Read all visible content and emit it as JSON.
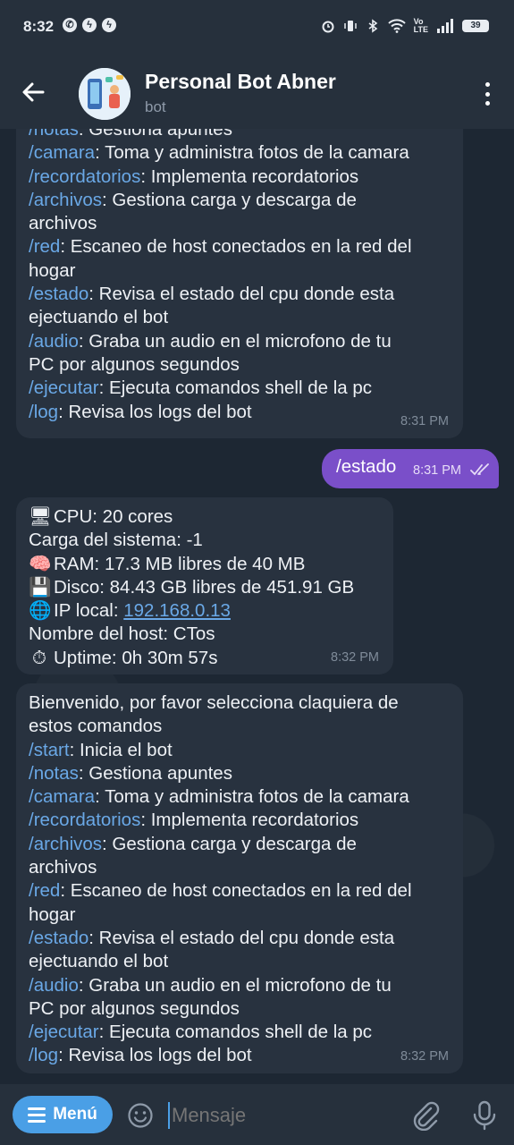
{
  "status_bar": {
    "time": "8:32",
    "battery": "39"
  },
  "header": {
    "title": "Personal Bot Abner",
    "subtitle": "bot"
  },
  "messages": {
    "m1": {
      "lines": [
        {
          "cmd": "/notas",
          "rest": ": Gestiona apuntes"
        },
        {
          "cmd": "/camara",
          "rest": ": Toma y administra fotos de la camara"
        },
        {
          "cmd": "/recordatorios",
          "rest": ": Implementa recordatorios"
        },
        {
          "cmd": "/archivos",
          "rest": ": Gestiona carga y descarga de"
        },
        {
          "cmd": "",
          "rest": "archivos"
        },
        {
          "cmd": "/red",
          "rest": ": Escaneo de host conectados en la red del"
        },
        {
          "cmd": "",
          "rest": "hogar"
        },
        {
          "cmd": "/estado",
          "rest": ": Revisa el estado del cpu donde esta"
        },
        {
          "cmd": "",
          "rest": "ejectuando el bot"
        },
        {
          "cmd": "/audio",
          "rest": ": Graba un audio en el microfono de tu"
        },
        {
          "cmd": "",
          "rest": "PC por algunos segundos"
        },
        {
          "cmd": "/ejecutar",
          "rest": ": Ejecuta comandos shell de la pc"
        },
        {
          "cmd": "/log",
          "rest": ": Revisa los logs del bot"
        }
      ],
      "time": "8:31 PM"
    },
    "m2": {
      "text": "/estado",
      "time": "8:31 PM"
    },
    "m3": {
      "cpu": "CPU: 20 cores",
      "load": "Carga del sistema: -1",
      "ram": "RAM: 17.3 MB libres de 40 MB",
      "disk": "Disco: 84.43 GB libres de 451.91 GB",
      "ip_label": "IP local: ",
      "ip_value": "192.168.0.13",
      "host": "Nombre del host: CTos",
      "uptime": "Uptime: 0h 30m 57s",
      "time": "8:32 PM"
    },
    "m4": {
      "intro1": "Bienvenido, por favor selecciona claquiera de",
      "intro2": "estos comandos",
      "lines": [
        {
          "cmd": "/start",
          "rest": ": Inicia el bot"
        },
        {
          "cmd": "/notas",
          "rest": ": Gestiona apuntes"
        },
        {
          "cmd": "/camara",
          "rest": ": Toma y administra fotos de la camara"
        },
        {
          "cmd": "/recordatorios",
          "rest": ": Implementa recordatorios"
        },
        {
          "cmd": "/archivos",
          "rest": ": Gestiona carga y descarga de"
        },
        {
          "cmd": "",
          "rest": "archivos"
        },
        {
          "cmd": "/red",
          "rest": ": Escaneo de host conectados en la red del"
        },
        {
          "cmd": "",
          "rest": "hogar"
        },
        {
          "cmd": "/estado",
          "rest": ": Revisa el estado del cpu donde esta"
        },
        {
          "cmd": "",
          "rest": "ejectuando el bot"
        },
        {
          "cmd": "/audio",
          "rest": ": Graba un audio en el microfono de tu"
        },
        {
          "cmd": "",
          "rest": "PC por algunos segundos"
        },
        {
          "cmd": "/ejecutar",
          "rest": ": Ejecuta comandos shell de la pc"
        },
        {
          "cmd": "/log",
          "rest": ": Revisa los logs del bot"
        }
      ],
      "time": "8:32 PM"
    }
  },
  "input_bar": {
    "menu_label": "Menú",
    "placeholder": "Mensaje"
  },
  "colors": {
    "accent": "#4a9fe6",
    "outgoing_bubble": "#7a4fc9",
    "incoming_bubble": "#28323f",
    "command_link": "#6aa8e6"
  }
}
